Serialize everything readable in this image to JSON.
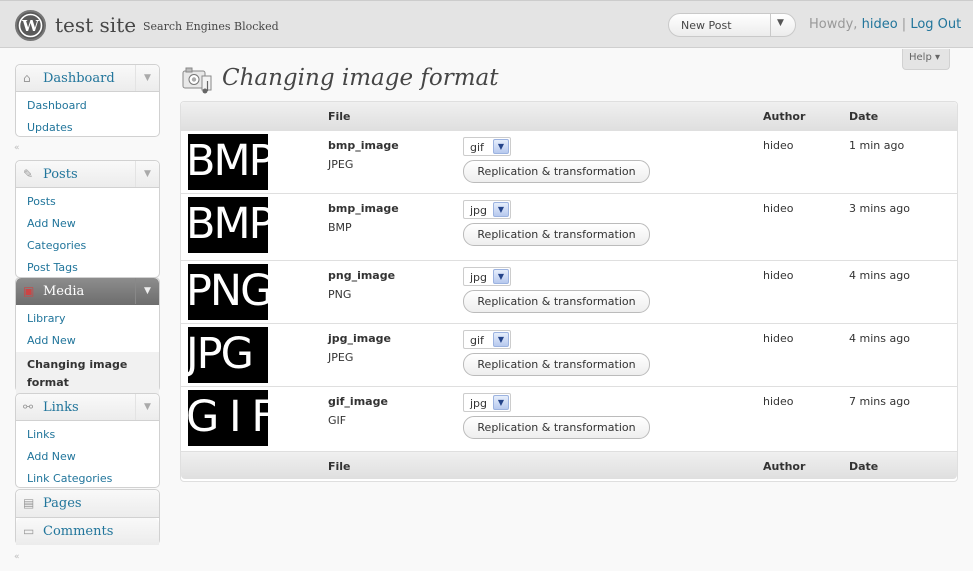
{
  "header": {
    "site_title": "test site",
    "site_subtitle": "Search Engines Blocked",
    "favorite_action": "New Post",
    "howdy": "Howdy,",
    "username": "hideo",
    "separator": "|",
    "logout": "Log Out"
  },
  "help": {
    "label": "Help ▾"
  },
  "sidebar": {
    "dashboard": {
      "label": "Dashboard",
      "items": [
        "Dashboard",
        "Updates"
      ]
    },
    "posts": {
      "label": "Posts",
      "items": [
        "Posts",
        "Add New",
        "Categories",
        "Post Tags"
      ]
    },
    "media": {
      "label": "Media",
      "items": [
        "Library",
        "Add New",
        "Changing image format"
      ]
    },
    "links": {
      "label": "Links",
      "items": [
        "Links",
        "Add New",
        "Link Categories"
      ]
    },
    "pages": {
      "label": "Pages"
    },
    "comments": {
      "label": "Comments"
    }
  },
  "page": {
    "title": "Changing image format"
  },
  "table": {
    "columns": {
      "file": "File",
      "author": "Author",
      "date": "Date"
    },
    "button_label": "Replication & transformation",
    "rows": [
      {
        "thumb": "BMP",
        "name": "bmp_image",
        "type": "JPEG",
        "format": "gif",
        "author": "hideo",
        "date": "1 min ago"
      },
      {
        "thumb": "BMP",
        "name": "bmp_image",
        "type": "BMP",
        "format": "jpg",
        "author": "hideo",
        "date": "3 mins ago"
      },
      {
        "thumb": "PNG",
        "name": "png_image",
        "type": "PNG",
        "format": "jpg",
        "author": "hideo",
        "date": "4 mins ago"
      },
      {
        "thumb": "JPG",
        "name": "jpg_image",
        "type": "JPEG",
        "format": "gif",
        "author": "hideo",
        "date": "4 mins ago"
      },
      {
        "thumb": "G I F",
        "name": "gif_image",
        "type": "GIF",
        "format": "jpg",
        "author": "hideo",
        "date": "7 mins ago"
      }
    ]
  }
}
